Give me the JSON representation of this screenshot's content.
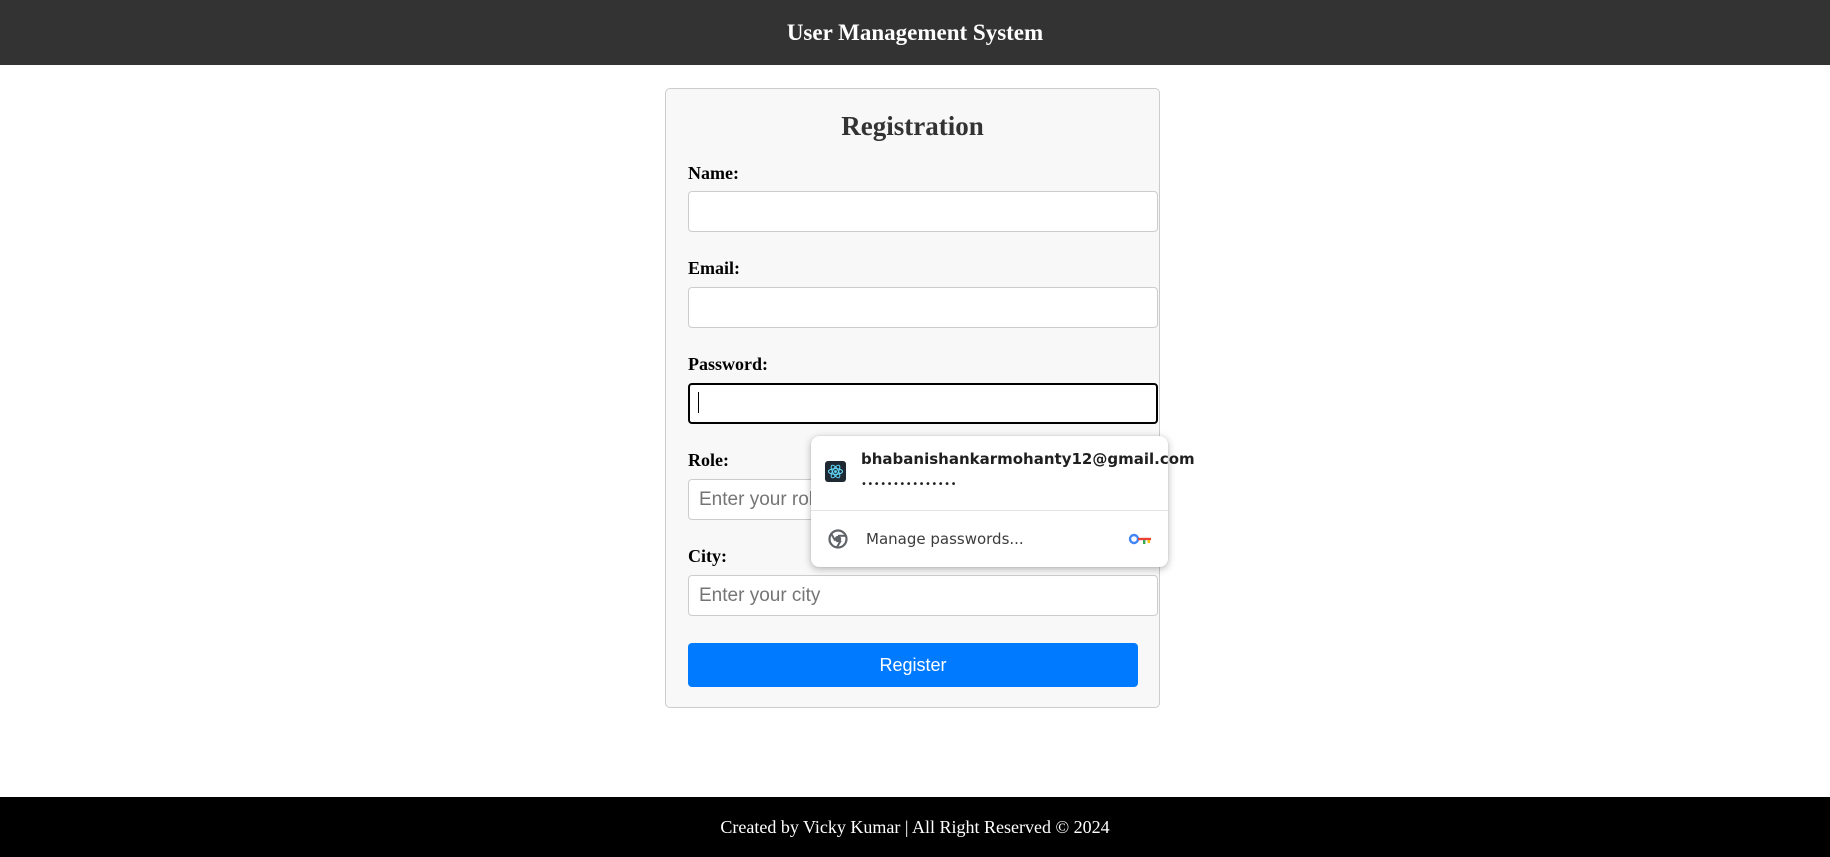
{
  "header": {
    "title": "User Management System"
  },
  "form": {
    "title": "Registration",
    "name": {
      "label": "Name:",
      "value": "",
      "placeholder": ""
    },
    "email": {
      "label": "Email:",
      "value": "",
      "placeholder": ""
    },
    "password": {
      "label": "Password:",
      "value": "",
      "placeholder": ""
    },
    "role": {
      "label": "Role:",
      "value": "",
      "placeholder": "Enter your role"
    },
    "city": {
      "label": "City:",
      "value": "",
      "placeholder": "Enter your city"
    },
    "submit_label": "Register"
  },
  "password_popup": {
    "saved_email": "bhabanishankarmohanty12@gmail.com",
    "saved_password_mask": "•••••••••••••••",
    "manage_label": "Manage passwords...",
    "site_icon": "react-icon",
    "manage_icon": "chrome-icon",
    "key_icon": "google-key-icon"
  },
  "footer": {
    "text": "Created by Vicky Kumar | All Right Reserved © 2024"
  },
  "colors": {
    "header_bg": "#333333",
    "footer_bg": "#000000",
    "button_bg": "#007bff",
    "card_bg": "#f8f8f8"
  }
}
